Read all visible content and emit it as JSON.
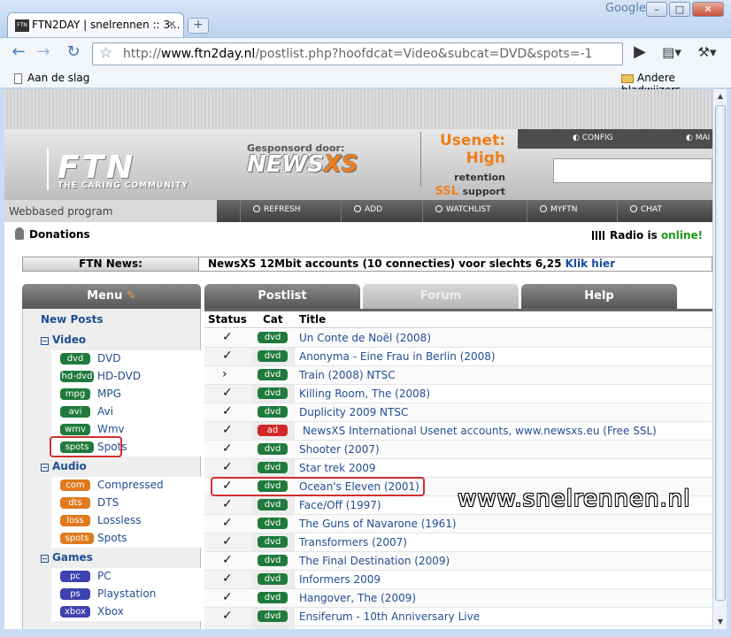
{
  "browser": {
    "tab_title": "FTN2DAY | snelrennen :: 3...",
    "favicon_text": "FTN",
    "new_tab": "+",
    "brand": "Google",
    "url_prefix": "http://",
    "url_domain": "www.ftn2day.nl",
    "url_path": "/postlist.php?hoofdcat=Video&subcat=DVD&spots=-1",
    "bookmark_left": "Aan de slag",
    "bookmark_right": "Andere bladwijzers"
  },
  "header": {
    "logo": "FTN",
    "logo_sub": "THE CARING COMMUNITY",
    "sponsor_label": "Gesponsord door:",
    "sponsor_a": "NEWS",
    "sponsor_b": "XS",
    "usenet": "Usenet:",
    "high": "High",
    "retention": "retention",
    "ssl": "SSL",
    "support": "support",
    "config": "CONFIG",
    "mail": "MAI"
  },
  "nav": {
    "webbased": "Webbased program",
    "refresh": "REFRESH",
    "add": "ADD",
    "watchlist": "WATCHLIST",
    "myftn": "MYFTN",
    "chat": "CHAT"
  },
  "info": {
    "donations": "Donations",
    "radio_label": "Radio",
    "radio_is": "is",
    "radio_status": "online!",
    "news_label": "FTN News:",
    "news_text": "NewsXS 12Mbit accounts (10 connecties) voor slechts 6,25",
    "news_link": "Klik hier"
  },
  "sidebar": {
    "title": "Menu",
    "new_posts": "New Posts",
    "video": "Video",
    "audio": "Audio",
    "games": "Games",
    "toggle": "−",
    "video_items": [
      {
        "badge": "dvd",
        "label": "DVD"
      },
      {
        "badge": "hd-dvd",
        "label": "HD-DVD"
      },
      {
        "badge": "mpg",
        "label": "MPG"
      },
      {
        "badge": "avi",
        "label": "Avi"
      },
      {
        "badge": "wmv",
        "label": "Wmv"
      },
      {
        "badge": "spots",
        "label": "Spots"
      }
    ],
    "audio_items": [
      {
        "badge": "com",
        "label": "Compressed"
      },
      {
        "badge": "dts",
        "label": "DTS"
      },
      {
        "badge": "loss",
        "label": "Lossless"
      },
      {
        "badge": "spots",
        "label": "Spots"
      }
    ],
    "games_items": [
      {
        "badge": "pc",
        "label": "PC"
      },
      {
        "badge": "ps",
        "label": "Playstation"
      },
      {
        "badge": "xbox",
        "label": "Xbox"
      }
    ]
  },
  "tabs": {
    "postlist": "Postlist",
    "forum": "Forum",
    "help": "Help"
  },
  "columns": {
    "status": "Status",
    "cat": "Cat",
    "title": "Title"
  },
  "rows": [
    {
      "status": "✓",
      "cat": "dvd",
      "title": "Un Conte de Noël (2008)"
    },
    {
      "status": "✓",
      "cat": "dvd",
      "title": "Anonyma - Eine Frau in Berlin (2008)"
    },
    {
      "status": "›",
      "cat": "dvd",
      "title": "Train (2008) NTSC"
    },
    {
      "status": "✓",
      "cat": "dvd",
      "title": "Killing Room, The (2008)"
    },
    {
      "status": "✓",
      "cat": "dvd",
      "title": "Duplicity 2009 NTSC"
    },
    {
      "status": "✓",
      "cat": "ad",
      "title": "NewsXS International Usenet accounts, www.newsxs.eu (Free SSL)"
    },
    {
      "status": "✓",
      "cat": "dvd",
      "title": "Shooter (2007)"
    },
    {
      "status": "✓",
      "cat": "dvd",
      "title": "Star trek 2009"
    },
    {
      "status": "✓",
      "cat": "dvd",
      "title": "Ocean's Eleven (2001)"
    },
    {
      "status": "✓",
      "cat": "dvd",
      "title": "Face/Off (1997)"
    },
    {
      "status": "✓",
      "cat": "dvd",
      "title": "The Guns of Navarone (1961)"
    },
    {
      "status": "✓",
      "cat": "dvd",
      "title": "Transformers (2007)"
    },
    {
      "status": "✓",
      "cat": "dvd",
      "title": "The Final Destination (2009)"
    },
    {
      "status": "✓",
      "cat": "dvd",
      "title": "Informers 2009"
    },
    {
      "status": "✓",
      "cat": "dvd",
      "title": "Hangover, The (2009)"
    },
    {
      "status": "✓",
      "cat": "dvd",
      "title": "Ensiferum - 10th Anniversary Live"
    }
  ],
  "watermark": "www.snelrennen.nl",
  "colors": {
    "dvd_green": "#1f7a3c",
    "ad_red": "#d42727",
    "audio_orange": "#e07a1f",
    "games_purple": "#3e42b0",
    "accent_orange": "#ef7f1a",
    "highlight_red": "#d03030"
  }
}
